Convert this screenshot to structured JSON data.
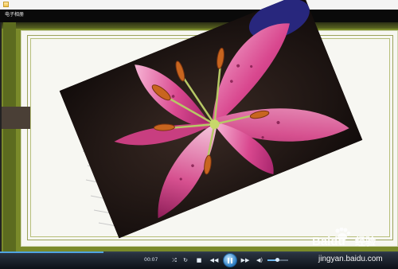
{
  "window": {
    "title_icon": "app-icon",
    "tab_label": "电子相册"
  },
  "player": {
    "time": "00:07",
    "progress": 0.26,
    "volume": 0.45,
    "controls": [
      "shuffle-icon",
      "repeat-icon",
      "stop-icon",
      "previous-icon",
      "pause-icon",
      "next-icon",
      "volume-icon"
    ]
  },
  "watermark": {
    "brand": "Baidu",
    "suffix": "经验",
    "url": "jingyan.baidu.com"
  },
  "colors": {
    "frame_olive": "#7a8a2a",
    "page_bg": "#f7f7f2",
    "accent_blue": "#4fa3e0"
  }
}
